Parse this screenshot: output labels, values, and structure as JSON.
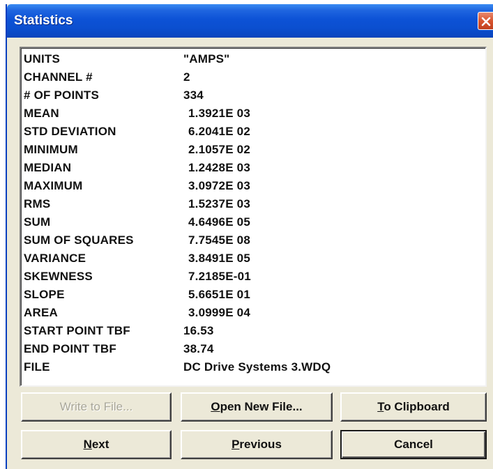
{
  "window": {
    "title": "Statistics"
  },
  "stats": [
    {
      "label": "UNITS",
      "value": "\"AMPS\""
    },
    {
      "label": "CHANNEL #",
      "value": "2"
    },
    {
      "label": "# OF POINTS",
      "value": "334"
    },
    {
      "label": "MEAN",
      "value": "1.3921E 03"
    },
    {
      "label": "STD DEVIATION",
      "value": "6.2041E 02"
    },
    {
      "label": "MINIMUM",
      "value": "2.1057E 02"
    },
    {
      "label": "MEDIAN",
      "value": "1.2428E 03"
    },
    {
      "label": "MAXIMUM",
      "value": "3.0972E 03"
    },
    {
      "label": "RMS",
      "value": "1.5237E 03"
    },
    {
      "label": "SUM",
      "value": "4.6496E 05"
    },
    {
      "label": "SUM OF SQUARES",
      "value": "7.7545E 08"
    },
    {
      "label": "VARIANCE",
      "value": "3.8491E 05"
    },
    {
      "label": "SKEWNESS",
      "value": "7.2185E-01"
    },
    {
      "label": "SLOPE",
      "value": "5.6651E 01"
    },
    {
      "label": "AREA",
      "value": "3.0999E 04"
    },
    {
      "label": "START POINT TBF",
      "value": "16.53"
    },
    {
      "label": "END POINT TBF",
      "value": "38.74"
    },
    {
      "label": "FILE",
      "value": "DC Drive Systems 3.WDQ"
    }
  ],
  "buttons": {
    "write_to_file": "Write to File...",
    "open_new_file": {
      "mnemonic": "O",
      "rest": "pen New File..."
    },
    "to_clipboard": {
      "mnemonic": "T",
      "rest": "o Clipboard"
    },
    "next": {
      "mnemonic": "N",
      "rest": "ext"
    },
    "previous": {
      "mnemonic": "P",
      "rest": "revious"
    },
    "cancel": "Cancel"
  }
}
